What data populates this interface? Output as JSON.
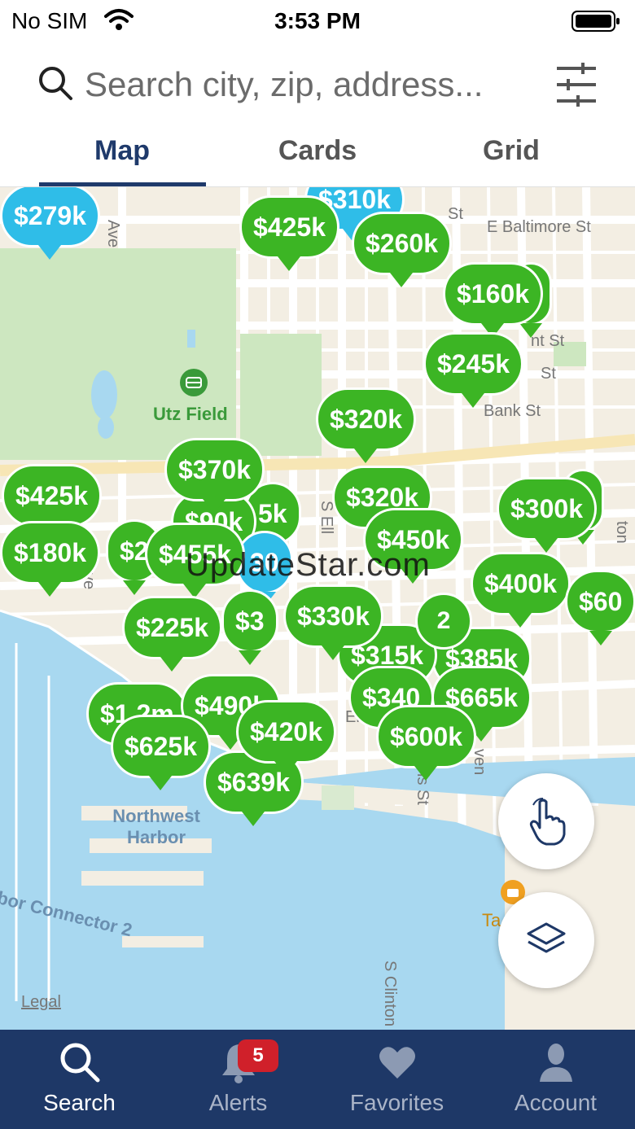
{
  "status_bar": {
    "carrier": "No SIM",
    "time": "3:53 PM"
  },
  "search": {
    "placeholder": "Search city, zip, address..."
  },
  "view_tabs": [
    {
      "label": "Map",
      "active": true
    },
    {
      "label": "Cards",
      "active": false
    },
    {
      "label": "Grid",
      "active": false
    }
  ],
  "map": {
    "street_labels": [
      "E Baltimore St",
      "Bank St",
      "nt St",
      "St",
      "St",
      "S Clinton St",
      "Ave",
      "Ave",
      "S Ell",
      "ton",
      "is St",
      "ven",
      "Ell"
    ],
    "park_label": "Utz Field",
    "water_label": "Northwest Harbor",
    "connector_label": "bor Connector 2",
    "legal": "Legal",
    "poi_label": "Ta",
    "price_pins": [
      {
        "label": "$279k",
        "color": "blue"
      },
      {
        "label": "$310k",
        "color": "blue"
      },
      {
        "label": "$425k",
        "color": "green"
      },
      {
        "label": "$260k",
        "color": "green"
      },
      {
        "label": "k",
        "color": "green"
      },
      {
        "label": "$160k",
        "color": "green"
      },
      {
        "label": "$245k",
        "color": "green"
      },
      {
        "label": "$320k",
        "color": "green"
      },
      {
        "label": "$370k",
        "color": "green"
      },
      {
        "label": "$425k",
        "color": "green"
      },
      {
        "label": "5k",
        "color": "green"
      },
      {
        "label": "$90k",
        "color": "green"
      },
      {
        "label": "$320k",
        "color": "green"
      },
      {
        "label": "k",
        "color": "green"
      },
      {
        "label": "$300k",
        "color": "green"
      },
      {
        "label": "$180k",
        "color": "green"
      },
      {
        "label": "$2",
        "color": "green"
      },
      {
        "label": "$455k",
        "color": "green"
      },
      {
        "label": "30",
        "color": "blue"
      },
      {
        "label": "$450k",
        "color": "green"
      },
      {
        "label": "$400k",
        "color": "green"
      },
      {
        "label": "$60",
        "color": "green"
      },
      {
        "label": "$225k",
        "color": "green"
      },
      {
        "label": "$3",
        "color": "green"
      },
      {
        "label": "$330k",
        "color": "green"
      },
      {
        "label": "$315k",
        "color": "green"
      },
      {
        "label": "$385k",
        "color": "green"
      },
      {
        "label": "$1.2m",
        "color": "green"
      },
      {
        "label": "$490k",
        "color": "green"
      },
      {
        "label": "$340",
        "color": "green"
      },
      {
        "label": "$665k",
        "color": "green"
      },
      {
        "label": "$625k",
        "color": "green"
      },
      {
        "label": "$420k",
        "color": "green"
      },
      {
        "label": "$600k",
        "color": "green"
      },
      {
        "label": "$639k",
        "color": "green"
      }
    ],
    "cluster": {
      "count": "2"
    }
  },
  "watermark": "UpdateStar.com",
  "bottom_nav": [
    {
      "label": "Search",
      "icon": "search-icon",
      "active": true
    },
    {
      "label": "Alerts",
      "icon": "bell-icon",
      "active": false,
      "badge": "5"
    },
    {
      "label": "Favorites",
      "icon": "heart-icon",
      "active": false
    },
    {
      "label": "Account",
      "icon": "person-icon",
      "active": false
    }
  ],
  "colors": {
    "navy": "#1e3867",
    "pin_green": "#3cb524",
    "pin_blue": "#2fbde8",
    "water": "#a8d8f0",
    "park": "#cde7c0",
    "badge_red": "#d0202a"
  }
}
